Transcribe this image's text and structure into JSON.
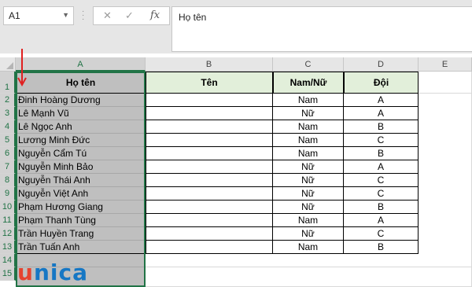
{
  "formula_bar": {
    "name_box": "A1",
    "formula": "Họ tên",
    "icons": [
      "cancel-x-icon",
      "enter-check-icon",
      "fx-icon"
    ]
  },
  "columns": [
    "A",
    "B",
    "C",
    "D",
    "E"
  ],
  "rows": [
    "1",
    "2",
    "3",
    "4",
    "5",
    "6",
    "7",
    "8",
    "9",
    "10",
    "11",
    "12",
    "13",
    "14",
    "15"
  ],
  "header": {
    "a": "Họ tên",
    "b": "Tên",
    "c": "Nam/Nữ",
    "d": "Đội"
  },
  "records": [
    {
      "name": "Đinh Hoàng Dương",
      "gender": "Nam",
      "team": "A"
    },
    {
      "name": "Lê Mạnh Vũ",
      "gender": "Nữ",
      "team": "A"
    },
    {
      "name": "Lê Ngọc Anh",
      "gender": "Nam",
      "team": "B"
    },
    {
      "name": "Lương Minh Đức",
      "gender": "Nam",
      "team": "C"
    },
    {
      "name": "Nguyễn Cẩm Tú",
      "gender": "Nam",
      "team": "B"
    },
    {
      "name": "Nguyễn Minh Bảo",
      "gender": "Nữ",
      "team": "A"
    },
    {
      "name": "Nguyễn Thái Anh",
      "gender": "Nữ",
      "team": "C"
    },
    {
      "name": "Nguyễn Việt Anh",
      "gender": "Nữ",
      "team": "C"
    },
    {
      "name": "Phạm Hương Giang",
      "gender": "Nữ",
      "team": "B"
    },
    {
      "name": "Phạm Thanh Tùng",
      "gender": "Nam",
      "team": "A"
    },
    {
      "name": "Trần Huyền Trang",
      "gender": "Nữ",
      "team": "C"
    },
    {
      "name": "Trần Tuấn Anh",
      "gender": "Nam",
      "team": "B"
    }
  ],
  "selected_column": "A",
  "colors": {
    "accent": "#217346",
    "header_fill": "#e2efda",
    "selection_fill": "#bfbfbf",
    "arrow": "#e02020"
  },
  "watermark": {
    "u": "u",
    "rest": "nica"
  }
}
